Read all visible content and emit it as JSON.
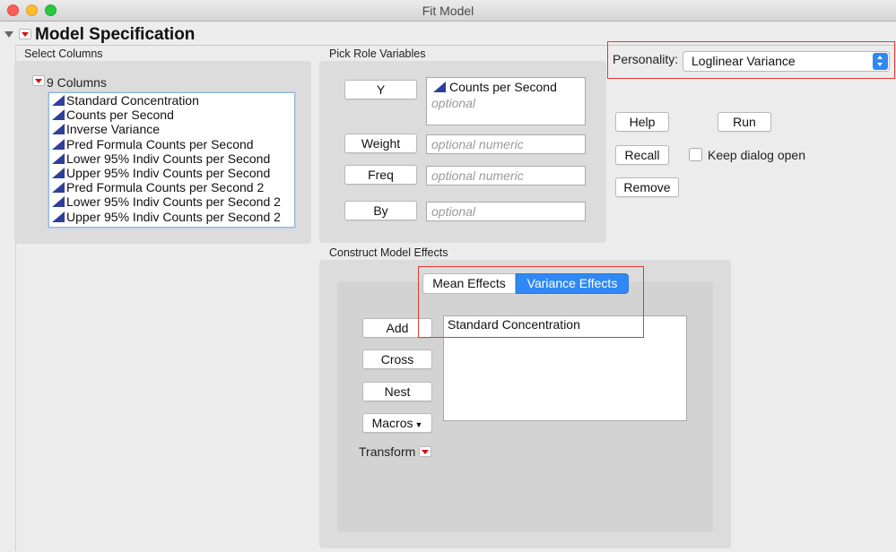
{
  "window": {
    "title": "Fit Model"
  },
  "header": {
    "title": "Model Specification"
  },
  "select_columns": {
    "label": "Select Columns",
    "count_label": "9 Columns",
    "columns": [
      "Standard Concentration",
      "Counts per Second",
      "Inverse Variance",
      "Pred Formula Counts per Second",
      "Lower 95% Indiv Counts per Second",
      "Upper 95% Indiv Counts per Second",
      "Pred Formula Counts per Second 2",
      "Lower 95% Indiv Counts per Second 2",
      "Upper 95% Indiv Counts per Second 2"
    ]
  },
  "pick_roles": {
    "label": "Pick Role Variables",
    "y_button": "Y",
    "y_value": "Counts per Second",
    "y_placeholder": "optional",
    "weight_button": "Weight",
    "weight_placeholder": "optional numeric",
    "freq_button": "Freq",
    "freq_placeholder": "optional numeric",
    "by_button": "By",
    "by_placeholder": "optional"
  },
  "personality": {
    "label": "Personality:",
    "value": "Loglinear Variance"
  },
  "actions": {
    "help": "Help",
    "run": "Run",
    "recall": "Recall",
    "remove": "Remove",
    "keep_open": "Keep dialog open"
  },
  "construct": {
    "label": "Construct Model Effects",
    "tabs": [
      "Mean Effects",
      "Variance Effects"
    ],
    "add": "Add",
    "cross": "Cross",
    "nest": "Nest",
    "macros": "Macros",
    "transform": "Transform",
    "effects": [
      "Standard Concentration"
    ]
  },
  "colors": {
    "accent": "#2f88f4",
    "highlight": "#e23a35",
    "continuous_icon": "#2e3f9a"
  }
}
